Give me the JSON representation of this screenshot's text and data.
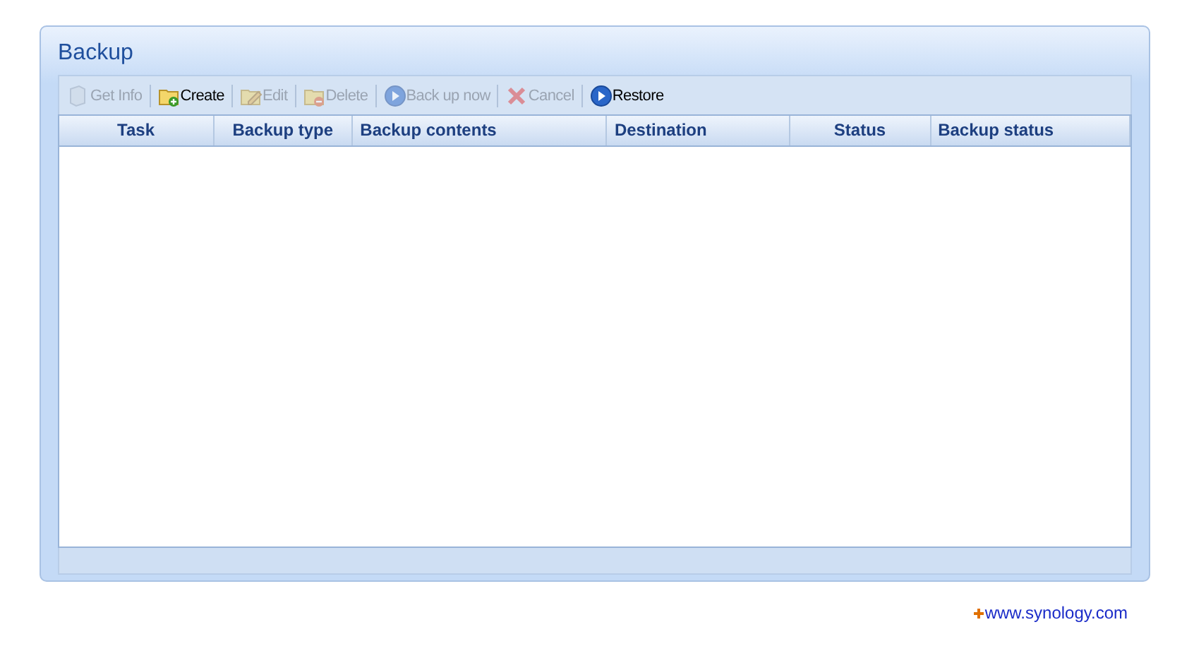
{
  "panel": {
    "title": "Backup"
  },
  "toolbar": [
    {
      "kind": "info",
      "label": "Get Info",
      "disabled": true
    },
    {
      "kind": "create",
      "label": "Create",
      "disabled": false
    },
    {
      "kind": "edit",
      "label": "Edit",
      "disabled": true
    },
    {
      "kind": "delete",
      "label": "Delete",
      "disabled": true
    },
    {
      "kind": "play",
      "label": "Back up now",
      "disabled": true
    },
    {
      "kind": "cancel",
      "label": "Cancel",
      "disabled": true
    },
    {
      "kind": "play",
      "label": "Restore",
      "disabled": false
    }
  ],
  "table": {
    "columns": [
      {
        "label": "Task"
      },
      {
        "label": "Backup type"
      },
      {
        "label": "Backup contents"
      },
      {
        "label": "Destination"
      },
      {
        "label": "Status"
      },
      {
        "label": "Backup status"
      }
    ]
  },
  "footer_link": "www.synology.com"
}
